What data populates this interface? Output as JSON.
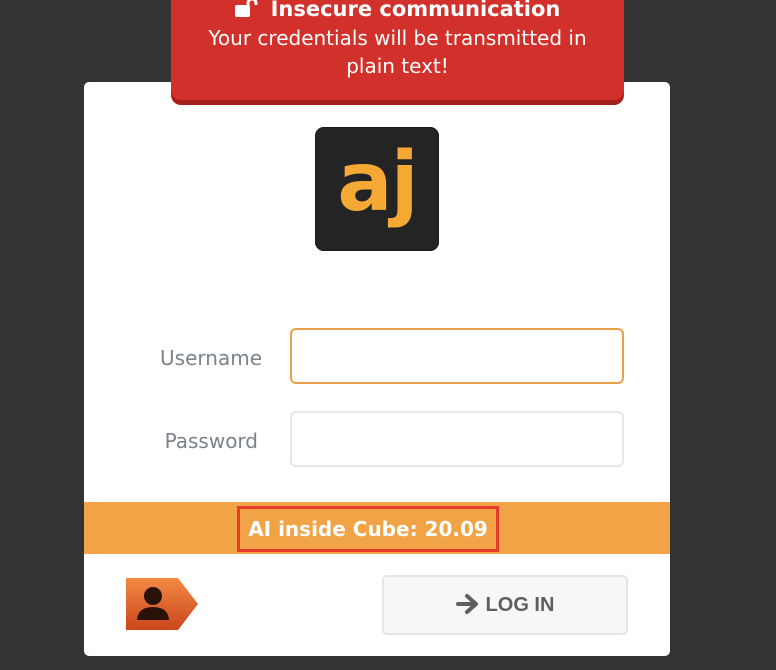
{
  "banner": {
    "title": "Insecure communication",
    "message": "Your credentials will be transmitted in plain text!",
    "icon": "unlocked-padlock-icon",
    "color": "#d2302a"
  },
  "logo": {
    "text": "aj",
    "color": "#f4a935"
  },
  "form": {
    "username_label": "Username",
    "password_label": "Password",
    "username_value": "",
    "password_value": ""
  },
  "status": {
    "text": "AI inside Cube: 20.09",
    "stripe_color": "#f1a346"
  },
  "actions": {
    "avatar_icon": "user-avatar-tag-icon",
    "login_label": "LOG IN",
    "login_icon": "arrow-right-icon"
  }
}
